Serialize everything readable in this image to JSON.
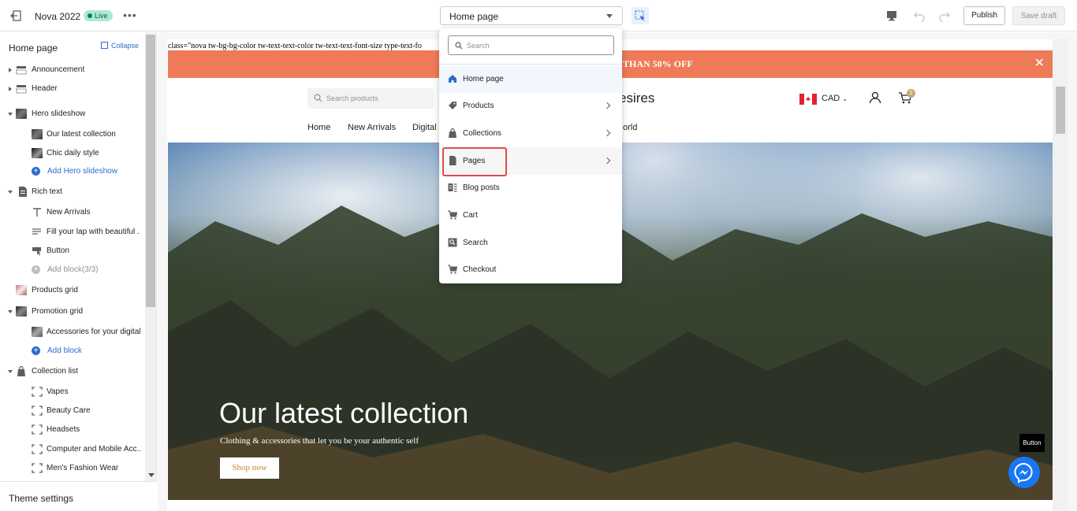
{
  "topbar": {
    "theme_name": "Nova 2022",
    "live_badge": "Live",
    "more": "•••",
    "page_select": "Home page",
    "publish": "Publish",
    "save_draft": "Save draft"
  },
  "sidebar": {
    "title": "Home page",
    "collapse": "Collapse",
    "items": [
      {
        "label": "Announcement"
      },
      {
        "label": "Header"
      },
      {
        "label": "Hero slideshow"
      },
      {
        "label": "Our latest collection"
      },
      {
        "label": "Chic daily style"
      },
      {
        "label": "Add Hero slideshow"
      },
      {
        "label": "Rich text"
      },
      {
        "label": "New Arrivals"
      },
      {
        "label": "Fill your lap with beautiful ..."
      },
      {
        "label": "Button"
      },
      {
        "label": "Add block(3/3)"
      },
      {
        "label": "Products grid"
      },
      {
        "label": "Promotion grid"
      },
      {
        "label": "Accessories for your digital..."
      },
      {
        "label": "Add block"
      },
      {
        "label": "Collection list"
      },
      {
        "label": "Vapes"
      },
      {
        "label": "Beauty Care"
      },
      {
        "label": "Headsets"
      },
      {
        "label": "Computer and Mobile Acc..."
      },
      {
        "label": "Men's Fashion Wear"
      }
    ],
    "footer": "Theme settings"
  },
  "preview": {
    "code_text": "class=\"nova tw-bg-bg-color tw-text-text-color tw-text-text-font-size type-text-fo",
    "announcement": "THAN 50% OFF",
    "close": "✕",
    "search_placeholder": "Search products",
    "logo_partial": "esires",
    "currency": "CAD",
    "cart_count": "2",
    "nav": [
      "Home",
      "New Arrivals",
      "Digital",
      "orld"
    ],
    "hero_title": "Our latest collection",
    "hero_subtitle": "Clothing & accessories that let you be your authentic self",
    "hero_button": "Shop now",
    "tooltip": "Button"
  },
  "dropdown": {
    "search_placeholder": "Search",
    "items": [
      {
        "label": "Home page",
        "icon": "home-icon"
      },
      {
        "label": "Products",
        "icon": "tag-icon"
      },
      {
        "label": "Collections",
        "icon": "collection-icon"
      },
      {
        "label": "Pages",
        "icon": "page-icon"
      },
      {
        "label": "Blog posts",
        "icon": "blog-icon"
      },
      {
        "label": "Cart",
        "icon": "cart-icon"
      },
      {
        "label": "Search",
        "icon": "search-icon"
      },
      {
        "label": "Checkout",
        "icon": "checkout-icon"
      }
    ]
  },
  "colors": {
    "accent": "#2c6ecb",
    "announcement_bg": "#ee7a58",
    "highlight": "#e04b4b"
  }
}
